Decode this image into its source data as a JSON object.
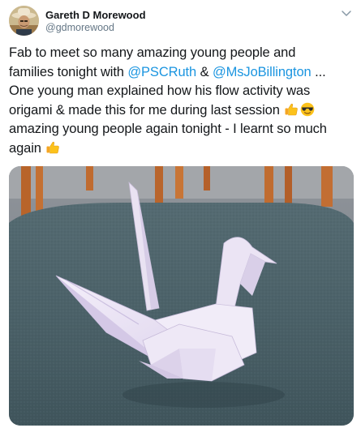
{
  "tweet": {
    "author": {
      "display_name": "Gareth D Morewood",
      "username": "@gdmorewood",
      "avatar_icon": "avatar-photo"
    },
    "menu_icon": "chevron-down-icon",
    "text": {
      "line1": "Fab to meet so many amazing young people and",
      "line2_before": "families tonight with ",
      "mention1": "@PSCRuth",
      "line2_mid": " & ",
      "mention2": "@MsJoBillington",
      "line2_after": " ...",
      "line3": "One young man explained how his flow activity was",
      "line4": "origami & made this for me during last session ",
      "line5": " amazing young people again tonight - I learnt so much",
      "line6": "again "
    },
    "emojis": [
      "thumbs-up-icon",
      "sunglasses-face-icon",
      "thumbs-up-icon"
    ],
    "photo": {
      "subject": "origami-crane-photo"
    },
    "colors": {
      "link": "#1b95e0",
      "secondary_text": "#657786",
      "primary_text": "#14171a"
    }
  }
}
